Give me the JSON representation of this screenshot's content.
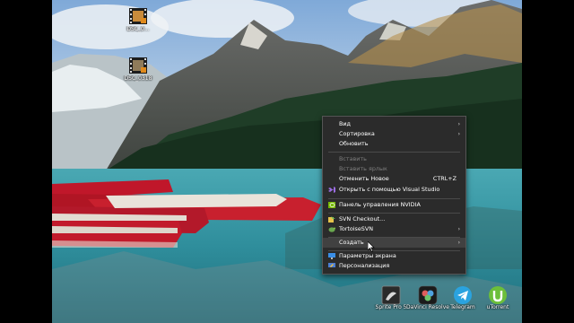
{
  "desktop_icons": [
    {
      "label": "DSC_0...",
      "icon": "video-file-icon"
    },
    {
      "label": "DSC_0318",
      "icon": "video-file-icon"
    }
  ],
  "context_menu": {
    "items": [
      {
        "label": "Вид",
        "submenu": true
      },
      {
        "label": "Сортировка",
        "submenu": true
      },
      {
        "label": "Обновить"
      },
      {
        "label": "Вставить",
        "disabled": true
      },
      {
        "label": "Вставить ярлык",
        "disabled": true
      },
      {
        "label": "Отменить Новое",
        "shortcut": "CTRL+Z"
      },
      {
        "label": "Открыть с помощью Visual Studio",
        "icon": "visual-studio-icon"
      },
      {
        "label": "Панель управления NVIDIA",
        "icon": "nvidia-icon"
      },
      {
        "label": "SVN Checkout...",
        "icon": "svn-checkout-icon"
      },
      {
        "label": "TortoiseSVN",
        "icon": "tortoisesvn-icon",
        "submenu": true
      },
      {
        "label": "Создать",
        "submenu": true,
        "highlighted": true
      },
      {
        "label": "Параметры экрана",
        "icon": "display-settings-icon"
      },
      {
        "label": "Персонализация",
        "icon": "personalization-icon"
      }
    ],
    "submenu_arrow": "›"
  },
  "taskbar_icons": [
    {
      "label": "Sprite Pro 5",
      "icon": "app-icon"
    },
    {
      "label": "DaVinci Resolve",
      "icon": "davinci-resolve-icon"
    },
    {
      "label": "Telegram",
      "icon": "telegram-icon"
    },
    {
      "label": "uTorrent",
      "icon": "utorrent-icon"
    }
  ],
  "colors": {
    "menu_bg": "#2b2b2b",
    "menu_highlight": "#414141",
    "canoe_red": "#c0172a",
    "lake": "#3e9aa6",
    "sky": "#a9c8e6"
  }
}
